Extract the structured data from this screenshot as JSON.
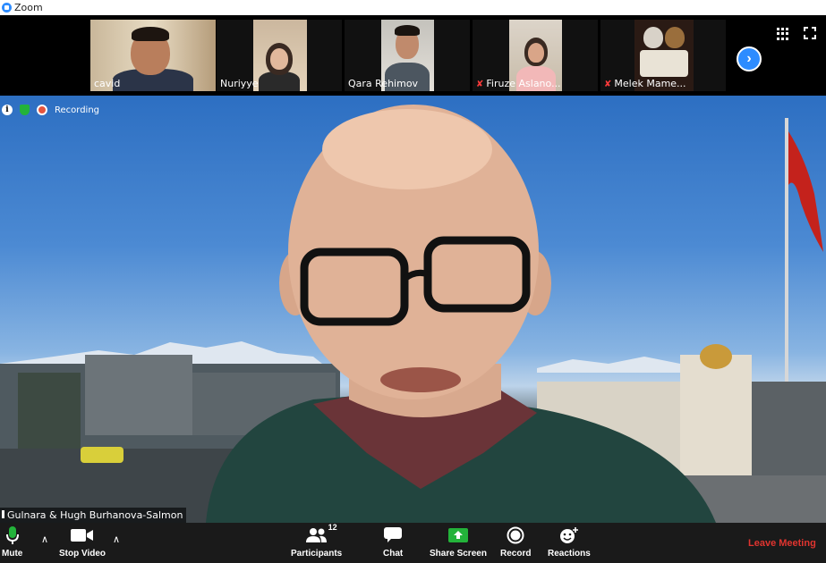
{
  "window": {
    "title": "Zoom"
  },
  "gallery": {
    "participants": [
      {
        "name": "cavid",
        "muted": false
      },
      {
        "name": "Nuriyye",
        "muted": false
      },
      {
        "name": "Qara Rehimov",
        "muted": false
      },
      {
        "name": "Firuze Aslano...",
        "muted": true
      },
      {
        "name": "Melek Mame...",
        "muted": true
      }
    ]
  },
  "meeting": {
    "recording_label": "Recording",
    "active_speaker": "Gulnara & Hugh Burhanova-Salmon"
  },
  "toolbar": {
    "mute": "Mute",
    "stop_video": "Stop Video",
    "participants": "Participants",
    "participants_count": "12",
    "chat": "Chat",
    "share_screen": "Share Screen",
    "record": "Record",
    "reactions": "Reactions",
    "leave": "Leave Meeting"
  },
  "colors": {
    "accent": "#2d8cff",
    "share_green": "#23b33a",
    "leave_red": "#e0342f",
    "muted_red": "#ff3b3b"
  },
  "icons": [
    "zoom-logo-icon",
    "next-page-icon",
    "gallery-grid-icon",
    "fullscreen-icon",
    "info-icon",
    "encryption-shield-icon",
    "recording-icon",
    "microphone-icon",
    "video-camera-icon",
    "participants-icon",
    "chat-icon",
    "share-screen-icon",
    "record-icon",
    "reactions-icon"
  ]
}
